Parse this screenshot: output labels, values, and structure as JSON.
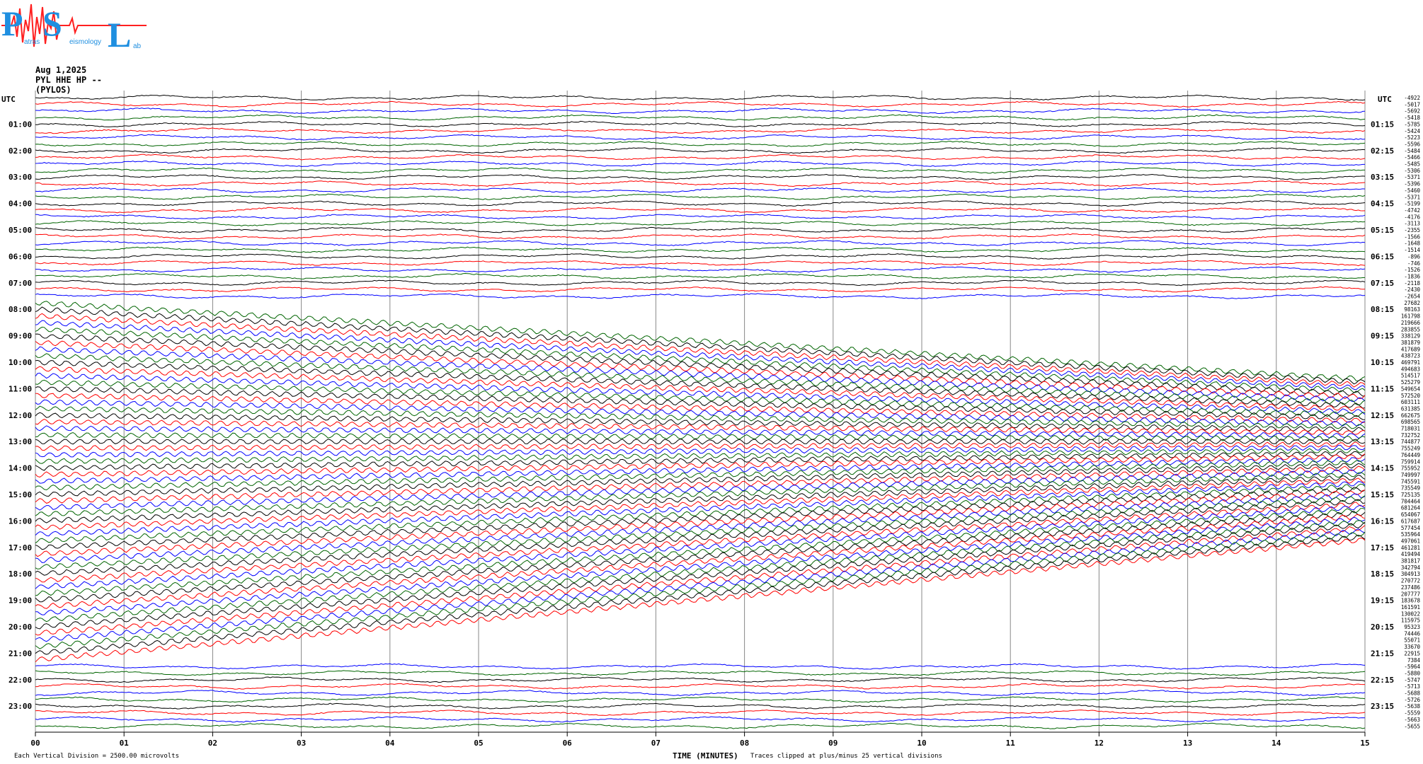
{
  "logo": {
    "letters": [
      "P",
      "S",
      "L"
    ],
    "small_text": [
      "atras",
      "eismology",
      "ab"
    ]
  },
  "header": {
    "date": "Aug 1,2025",
    "station": "PYL HHE HP --",
    "name": "(PYLOS)"
  },
  "footer": {
    "division_note": "Each Vertical Division = 2500.00 microvolts",
    "xlabel": "TIME (MINUTES)",
    "clip_note": "Traces clipped at plus/minus 25 vertical divisions"
  },
  "colors": {
    "trace_cycle": [
      "#000000",
      "#ff0000",
      "#0000ff",
      "#006400"
    ],
    "grid": "#888888"
  },
  "chart_data": {
    "type": "line",
    "description_kind": "helicorder",
    "xlabel": "TIME (MINUTES)",
    "xlim": [
      0,
      15
    ],
    "x_ticks": [
      "00",
      "01",
      "02",
      "03",
      "04",
      "05",
      "06",
      "07",
      "08",
      "09",
      "10",
      "11",
      "12",
      "13",
      "14",
      "15"
    ],
    "utc_label": "UTC",
    "left_hour_labels": [
      "01:00",
      "02:00",
      "03:00",
      "04:00",
      "05:00",
      "06:00",
      "07:00",
      "08:00",
      "09:00",
      "10:00",
      "11:00",
      "12:00",
      "13:00",
      "14:00",
      "15:00",
      "16:00",
      "17:00",
      "18:00",
      "19:00",
      "20:00",
      "21:00",
      "22:00",
      "23:00"
    ],
    "right_hour_labels": [
      "01:15",
      "02:15",
      "03:15",
      "04:15",
      "05:15",
      "06:15",
      "07:15",
      "08:15",
      "09:15",
      "10:15",
      "11:15",
      "12:15",
      "13:15",
      "14:15",
      "15:15",
      "16:15",
      "17:15",
      "18:15",
      "19:15",
      "20:15",
      "21:15",
      "22:15",
      "23:15"
    ],
    "line_count": 96,
    "line_minutes": 15,
    "mean_values": [
      "-4922",
      "-5017",
      "-5692",
      "-5418",
      "-5785",
      "-5424",
      "-5223",
      "-5596",
      "-5484",
      "-5466",
      "-5485",
      "-5306",
      "-5371",
      "-5396",
      "-5460",
      "-5371",
      "-5199",
      "-4742",
      "-4176",
      "-3113",
      "-2355",
      "-1566",
      "-1648",
      "-1514",
      "-896",
      "-746",
      "-1526",
      "-1836",
      "-2118",
      "-2430",
      "-2654",
      "27682",
      "98163",
      "161798",
      "219666",
      "283855",
      "338129",
      "381879",
      "417689",
      "438723",
      "469791",
      "494683",
      "514517",
      "525279",
      "549654",
      "572520",
      "603111",
      "631385",
      "662675",
      "698565",
      "718031",
      "732752",
      "744877",
      "755249",
      "764449",
      "759914",
      "755952",
      "749997",
      "745591",
      "735549",
      "725135",
      "704464",
      "681264",
      "654067",
      "617687",
      "577454",
      "535964",
      "497061",
      "461281",
      "419494",
      "381817",
      "342794",
      "304913",
      "270772",
      "237486",
      "207777",
      "183678",
      "161591",
      "130022",
      "115975",
      "95323",
      "74446",
      "55071",
      "33670",
      "22915",
      "7384",
      "-5964",
      "-5880",
      "-5747",
      "-5713",
      "-5688",
      "-5726",
      "-5638",
      "-5559",
      "-5663",
      "-5655"
    ],
    "trace_behavior": [
      {
        "range": "00:00-07:30",
        "description": "quiet microseism, small amplitude"
      },
      {
        "range": "07:45-21:15",
        "description": "large clipped oscillation with drifting baseline"
      },
      {
        "range": "21:30-23:45",
        "description": "quiet, flat"
      }
    ]
  }
}
